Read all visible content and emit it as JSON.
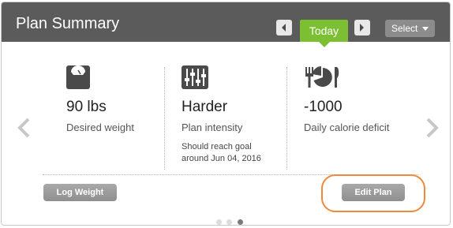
{
  "header": {
    "title": "Plan Summary",
    "today_label": "Today",
    "select_label": "Select"
  },
  "columns": [
    {
      "icon": "scale-icon",
      "value": "90 lbs",
      "label": "Desired weight"
    },
    {
      "icon": "sliders-icon",
      "value": "Harder",
      "label": "Plan intensity",
      "note_line1": "Should reach goal",
      "note_line2": "around Jun 04, 2016"
    },
    {
      "icon": "utensils-pie-icon",
      "value": "-1000",
      "label": "Daily calorie deficit"
    }
  ],
  "actions": {
    "log_weight": "Log Weight",
    "edit_plan": "Edit Plan"
  },
  "pagination": {
    "count": 3,
    "active_index": 2
  },
  "colors": {
    "header_bg": "#5b5b5b",
    "accent_green": "#7cbf33",
    "button_gray": "#9a9a9a",
    "highlight_orange": "#f2883b"
  }
}
